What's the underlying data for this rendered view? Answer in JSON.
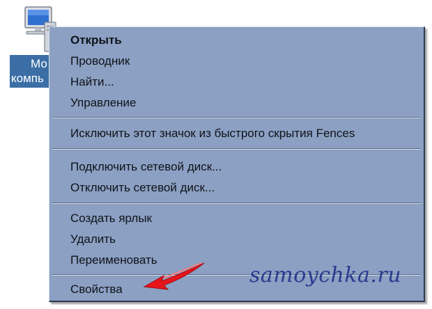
{
  "desktop_icon": {
    "label_line1": "Мо",
    "label_line2": "компь"
  },
  "context_menu": {
    "items": [
      {
        "label": "Открыть",
        "bold": true
      },
      {
        "label": "Проводник"
      },
      {
        "label": "Найти..."
      },
      {
        "label": "Управление"
      },
      {
        "label": "Исключить этот значок из быстрого скрытия Fences"
      },
      {
        "label": "Подключить сетевой диск..."
      },
      {
        "label": "Отключить сетевой диск..."
      },
      {
        "label": "Создать ярлык"
      },
      {
        "label": "Удалить"
      },
      {
        "label": "Переименовать"
      },
      {
        "label": "Свойства"
      }
    ]
  },
  "watermark": "samoychka.ru",
  "colors": {
    "menu_background": "#8ba0c2",
    "label_highlight": "#3c6ea6",
    "arrow": "#e8141c",
    "watermark": "#2a3b8f"
  },
  "icons": {
    "desktop": "my-computer-icon",
    "pointer": "red-arrow-icon"
  }
}
